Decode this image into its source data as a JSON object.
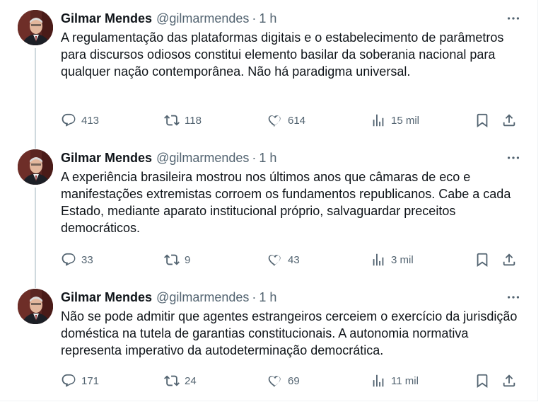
{
  "author": {
    "name": "Gilmar Mendes",
    "handle": "@gilmarmendes",
    "separator": "·"
  },
  "tweets": [
    {
      "time": "1 h",
      "text": "A regulamentação das plataformas digitais e o estabelecimento de parâmetros para discursos odiosos constitui elemento basilar da soberania nacional para qualquer nação contemporânea. Não há paradigma universal.",
      "replies": "413",
      "reposts": "118",
      "likes": "614",
      "views": "15 mil"
    },
    {
      "time": "1 h",
      "text": "A experiência brasileira mostrou nos últimos anos que câmaras de eco e manifestações extremistas corroem os fundamentos republicanos. Cabe a cada Estado, mediante aparato institucional próprio, salvaguardar preceitos democráticos.",
      "replies": "33",
      "reposts": "9",
      "likes": "43",
      "views": "3 mil"
    },
    {
      "time": "1 h",
      "text": "Não se pode admitir que agentes estrangeiros cerceiem o exercício da jurisdição doméstica na tutela de garantias constitucionais. A autonomia normativa representa imperativo da autodeterminação democrática.",
      "replies": "171",
      "reposts": "24",
      "likes": "69",
      "views": "11 mil"
    }
  ],
  "icons": {
    "reply": "reply-icon",
    "repost": "repost-icon",
    "like": "like-icon",
    "views": "views-icon",
    "bookmark": "bookmark-icon",
    "share": "share-icon",
    "more": "more-icon"
  },
  "colors": {
    "text": "#0f1419",
    "secondary": "#536471",
    "thread_line": "#cfd9de"
  }
}
